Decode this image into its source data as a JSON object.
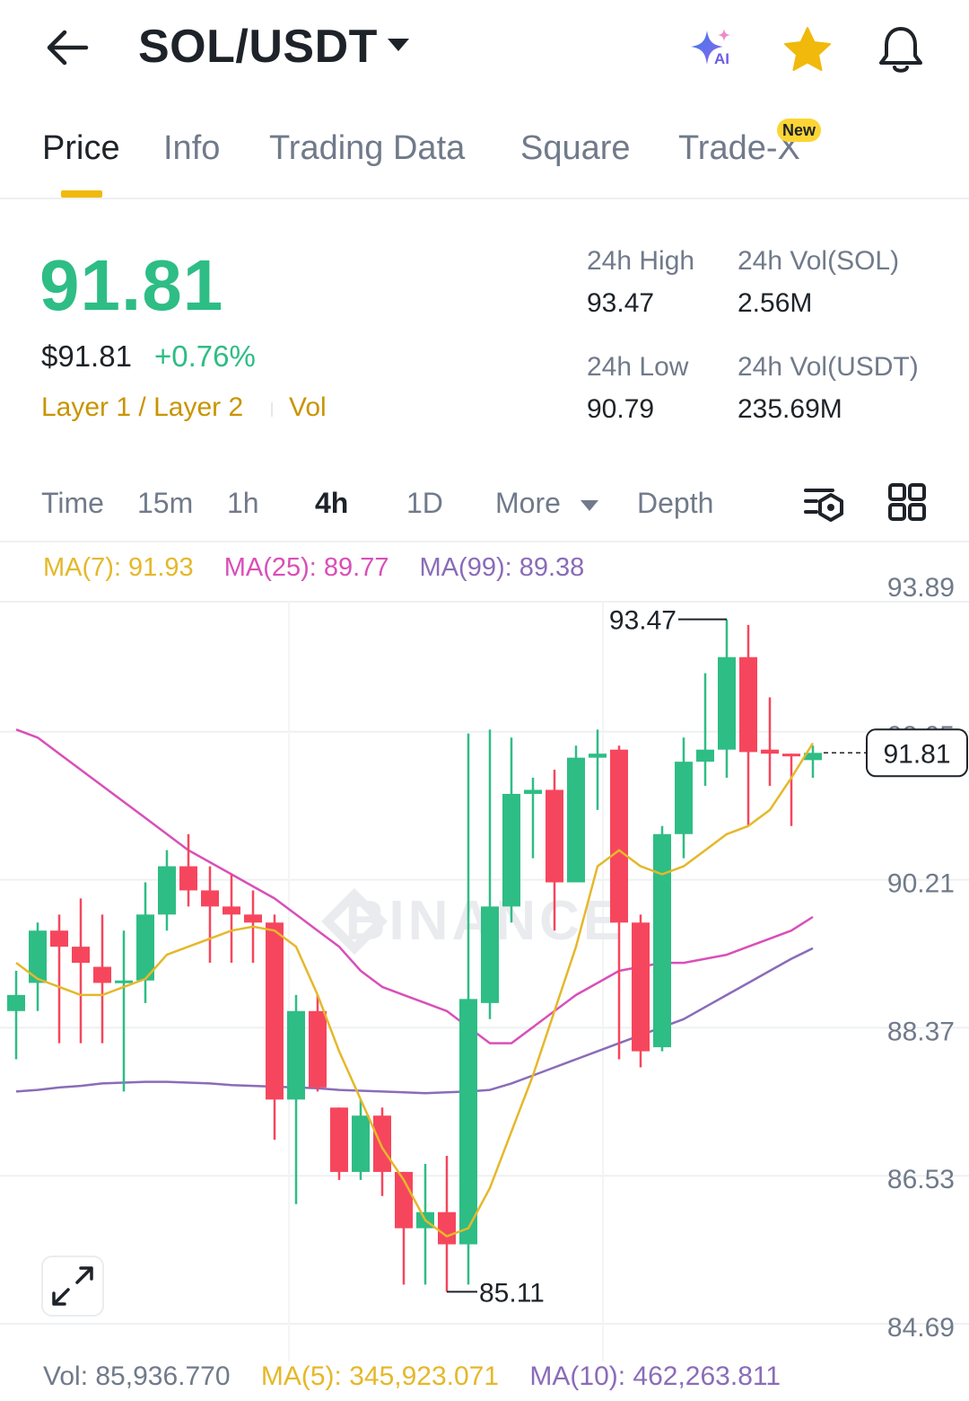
{
  "header": {
    "pair": "SOL/USDT",
    "icons": [
      "back-arrow-icon",
      "chevron-down-icon",
      "ai-sparkle-icon",
      "star-icon",
      "bell-icon"
    ],
    "ai_badge": "AI"
  },
  "tabs": [
    {
      "label": "Price",
      "active": true
    },
    {
      "label": "Info",
      "active": false
    },
    {
      "label": "Trading Data",
      "active": false
    },
    {
      "label": "Square",
      "active": false
    },
    {
      "label": "Trade-X",
      "active": false,
      "badge": "New"
    }
  ],
  "price": {
    "last": "91.81",
    "usd": "$91.81",
    "change": "+0.76%",
    "tags": [
      "Layer 1 / Layer 2",
      "Vol"
    ]
  },
  "stats": {
    "high_label": "24h High",
    "high_value": "93.47",
    "vol_sol_label": "24h Vol(SOL)",
    "vol_sol_value": "2.56M",
    "low_label": "24h Low",
    "low_value": "90.79",
    "vol_usdt_label": "24h Vol(USDT)",
    "vol_usdt_value": "235.69M"
  },
  "intervals": {
    "items": [
      "Time",
      "15m",
      "1h",
      "4h",
      "1D",
      "More",
      "Depth"
    ],
    "active": "4h",
    "tools": [
      "chart-settings-icon",
      "grid-layout-icon"
    ]
  },
  "ma": {
    "ma7": "MA(7): 91.93",
    "ma25": "MA(25): 89.77",
    "ma99": "MA(99): 89.38"
  },
  "volume": {
    "vol": "Vol: 85,936.770",
    "ma5": "MA(5): 345,923.071",
    "ma10": "MA(10): 462,263.811"
  },
  "colors": {
    "up": "#2ebd85",
    "down": "#f6465d",
    "ma7": "#e5b82a",
    "ma25": "#d94fb8",
    "ma99": "#8a6cb8",
    "accent": "#f0b90b"
  },
  "chart_data": {
    "type": "candlestick",
    "y_ticks": [
      "93.89",
      "92.05",
      "90.21",
      "88.37",
      "86.53",
      "84.69"
    ],
    "ylim": [
      84.69,
      93.89
    ],
    "high_marker": "93.47",
    "low_marker": "85.11",
    "last_marker": "91.81",
    "candles": [
      {
        "o": 88.6,
        "h": 89.1,
        "l": 88.0,
        "c": 88.8
      },
      {
        "o": 88.95,
        "h": 89.7,
        "l": 88.6,
        "c": 89.6
      },
      {
        "o": 89.6,
        "h": 89.8,
        "l": 88.2,
        "c": 89.4
      },
      {
        "o": 89.4,
        "h": 90.0,
        "l": 88.2,
        "c": 89.2
      },
      {
        "o": 89.15,
        "h": 89.8,
        "l": 88.2,
        "c": 88.95
      },
      {
        "o": 88.95,
        "h": 89.6,
        "l": 87.6,
        "c": 88.98
      },
      {
        "o": 88.98,
        "h": 90.2,
        "l": 88.7,
        "c": 89.8
      },
      {
        "o": 89.8,
        "h": 90.6,
        "l": 89.6,
        "c": 90.4
      },
      {
        "o": 90.4,
        "h": 90.8,
        "l": 89.9,
        "c": 90.1
      },
      {
        "o": 90.1,
        "h": 90.4,
        "l": 89.2,
        "c": 89.9
      },
      {
        "o": 89.9,
        "h": 90.3,
        "l": 89.2,
        "c": 89.8
      },
      {
        "o": 89.8,
        "h": 90.1,
        "l": 89.2,
        "c": 89.7
      },
      {
        "o": 89.7,
        "h": 89.8,
        "l": 87.0,
        "c": 87.5
      },
      {
        "o": 87.5,
        "h": 88.8,
        "l": 86.2,
        "c": 88.6
      },
      {
        "o": 88.6,
        "h": 88.8,
        "l": 87.6,
        "c": 87.65
      },
      {
        "o": 87.4,
        "h": 87.4,
        "l": 86.5,
        "c": 86.6
      },
      {
        "o": 86.6,
        "h": 87.5,
        "l": 86.5,
        "c": 87.3
      },
      {
        "o": 87.3,
        "h": 87.4,
        "l": 86.3,
        "c": 86.6
      },
      {
        "o": 86.6,
        "h": 86.6,
        "l": 85.2,
        "c": 85.9
      },
      {
        "o": 85.9,
        "h": 86.7,
        "l": 85.2,
        "c": 86.1
      },
      {
        "o": 86.1,
        "h": 86.8,
        "l": 85.11,
        "c": 85.7
      },
      {
        "o": 85.7,
        "h": 92.05,
        "l": 85.2,
        "c": 88.75
      },
      {
        "o": 88.7,
        "h": 92.1,
        "l": 88.5,
        "c": 89.9
      },
      {
        "o": 89.9,
        "h": 92.0,
        "l": 89.7,
        "c": 91.3
      },
      {
        "o": 91.3,
        "h": 91.5,
        "l": 90.5,
        "c": 91.35
      },
      {
        "o": 91.35,
        "h": 91.6,
        "l": 89.6,
        "c": 90.2
      },
      {
        "o": 90.2,
        "h": 91.9,
        "l": 90.2,
        "c": 91.75
      },
      {
        "o": 91.75,
        "h": 92.1,
        "l": 91.1,
        "c": 91.8
      },
      {
        "o": 91.85,
        "h": 91.9,
        "l": 88.0,
        "c": 89.7
      },
      {
        "o": 89.7,
        "h": 89.8,
        "l": 87.9,
        "c": 88.1
      },
      {
        "o": 88.15,
        "h": 90.9,
        "l": 88.1,
        "c": 90.8
      },
      {
        "o": 90.8,
        "h": 92.0,
        "l": 90.5,
        "c": 91.7
      },
      {
        "o": 91.7,
        "h": 92.8,
        "l": 91.4,
        "c": 91.85
      },
      {
        "o": 91.85,
        "h": 93.47,
        "l": 91.5,
        "c": 93.0
      },
      {
        "o": 93.0,
        "h": 93.4,
        "l": 90.9,
        "c": 91.82
      },
      {
        "o": 91.85,
        "h": 92.5,
        "l": 91.4,
        "c": 91.8
      },
      {
        "o": 91.8,
        "h": 91.8,
        "l": 90.9,
        "c": 91.78
      },
      {
        "o": 91.72,
        "h": 91.9,
        "l": 91.5,
        "c": 91.81
      }
    ],
    "ma7_line": [
      89.2,
      89.0,
      88.9,
      88.8,
      88.8,
      88.9,
      89.0,
      89.3,
      89.4,
      89.5,
      89.6,
      89.65,
      89.6,
      89.4,
      88.8,
      88.1,
      87.5,
      86.9,
      86.5,
      86.0,
      85.8,
      85.9,
      86.4,
      87.1,
      87.8,
      88.6,
      89.4,
      90.4,
      90.6,
      90.4,
      90.3,
      90.4,
      90.6,
      90.8,
      90.9,
      91.1,
      91.5,
      91.93
    ],
    "ma25_line": [
      92.1,
      92.0,
      91.8,
      91.6,
      91.4,
      91.2,
      91.0,
      90.8,
      90.6,
      90.45,
      90.3,
      90.15,
      90.0,
      89.8,
      89.6,
      89.4,
      89.1,
      88.9,
      88.8,
      88.7,
      88.6,
      88.4,
      88.2,
      88.2,
      88.4,
      88.6,
      88.8,
      88.95,
      89.1,
      89.15,
      89.2,
      89.2,
      89.25,
      89.3,
      89.4,
      89.5,
      89.6,
      89.77
    ],
    "ma99_line": [
      87.6,
      87.62,
      87.65,
      87.67,
      87.7,
      87.71,
      87.72,
      87.72,
      87.71,
      87.7,
      87.68,
      87.67,
      87.66,
      87.65,
      87.64,
      87.62,
      87.61,
      87.6,
      87.59,
      87.58,
      87.59,
      87.6,
      87.62,
      87.7,
      87.8,
      87.9,
      88.0,
      88.1,
      88.2,
      88.3,
      88.4,
      88.5,
      88.65,
      88.8,
      88.95,
      89.1,
      89.25,
      89.38
    ],
    "watermark": "BINANCE"
  }
}
